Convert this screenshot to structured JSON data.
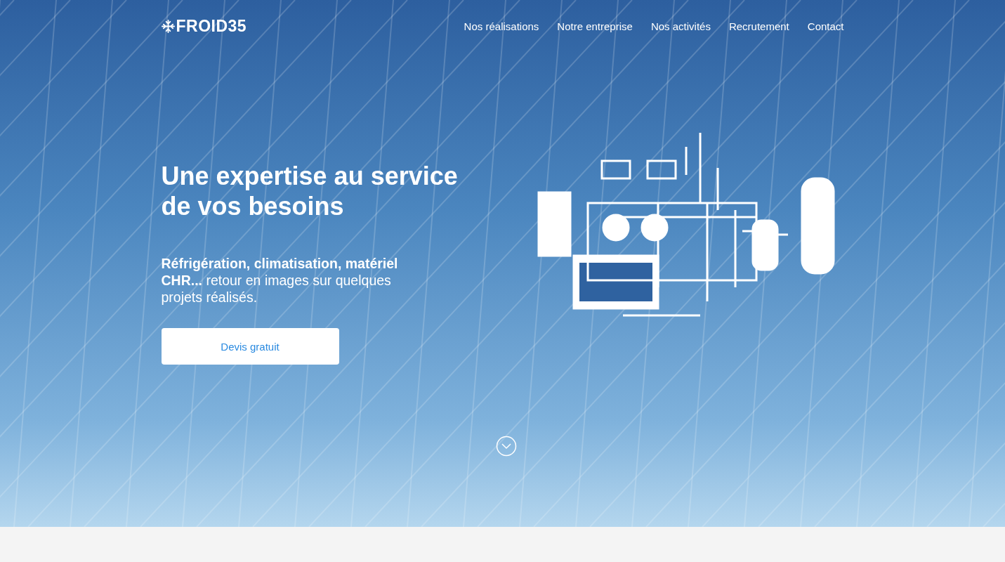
{
  "logo": {
    "text": "FROID35"
  },
  "nav": [
    {
      "label": "Nos réalisations"
    },
    {
      "label": "Notre entreprise"
    },
    {
      "label": "Nos activités"
    },
    {
      "label": "Recrutement"
    },
    {
      "label": "Contact"
    }
  ],
  "hero": {
    "title": "Une expertise au service de vos besoins",
    "subtitle": "**Réfrigération, climatisation, matériel CHR...** retour en images sur quelques projets réalisés.",
    "button": "Devis gratuit"
  }
}
